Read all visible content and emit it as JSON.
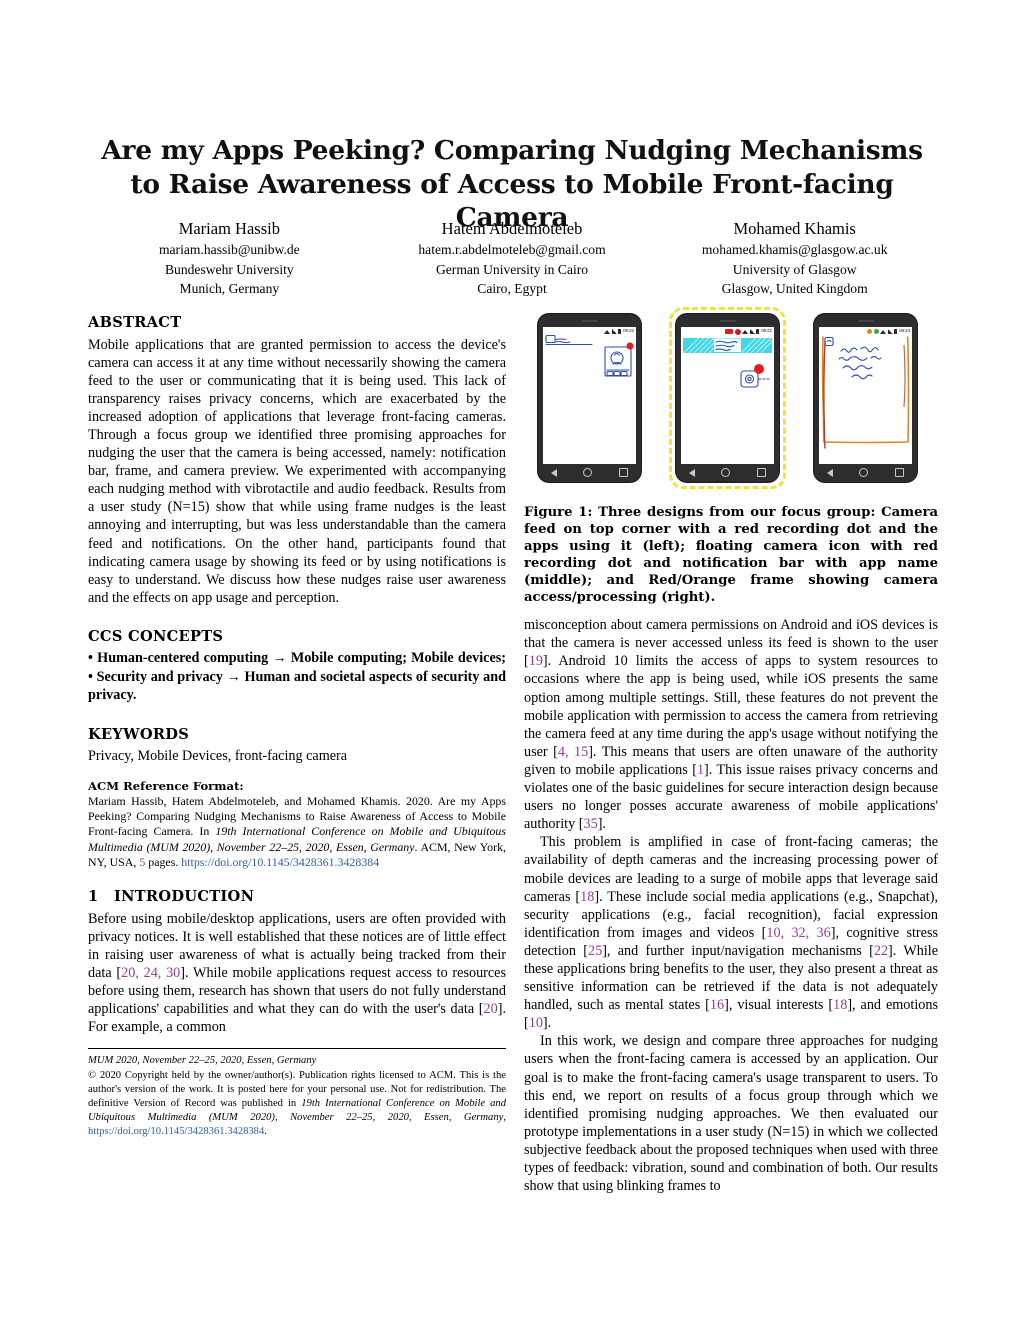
{
  "paper": {
    "title": "Are my Apps Peeking? Comparing Nudging Mechanisms to Raise Awareness of Access to Mobile Front-facing Camera",
    "authors": [
      {
        "name": "Mariam Hassib",
        "email": "mariam.hassib@unibw.de",
        "affiliation": "Bundeswehr University",
        "city": "Munich, Germany"
      },
      {
        "name": "Hatem Abdelmoteleb",
        "email": "hatem.r.abdelmoteleb@gmail.com",
        "affiliation": "German University in Cairo",
        "city": "Cairo, Egypt"
      },
      {
        "name": "Mohamed Khamis",
        "email": "mohamed.khamis@glasgow.ac.uk",
        "affiliation": "University of Glasgow",
        "city": "Glasgow, United Kingdom"
      }
    ]
  },
  "abstract": {
    "heading": "ABSTRACT",
    "text": "Mobile applications that are granted permission to access the device's camera can access it at any time without necessarily showing the camera feed to the user or communicating that it is being used. This lack of transparency raises privacy concerns, which are exacerbated by the increased adoption of applications that leverage front-facing cameras. Through a focus group we identified three promising approaches for nudging the user that the camera is being accessed, namely: notification bar, frame, and camera preview. We experimented with accompanying each nudging method with vibrotactile and audio feedback. Results from a user study (N=15) show that while using frame nudges is the least annoying and interrupting, but was less understandable than the camera feed and notifications. On the other hand, participants found that indicating camera usage by showing its feed or by using notifications is easy to understand. We discuss how these nudges raise user awareness and the effects on app usage and perception."
  },
  "ccs": {
    "heading": "CCS CONCEPTS",
    "text": "• Human-centered computing → Mobile computing; Mobile devices; • Security and privacy → Human and societal aspects of security and privacy."
  },
  "keywords": {
    "heading": "KEYWORDS",
    "text": "Privacy, Mobile Devices, front-facing camera"
  },
  "acm_reference": {
    "heading": "ACM Reference Format:",
    "part1": "Mariam Hassib, Hatem Abdelmoteleb, and Mohamed Khamis. 2020. Are my Apps Peeking? Comparing Nudging Mechanisms to Raise Awareness of Access to Mobile Front-facing Camera. In ",
    "venue_italic": "19th International Conference on Mobile and Ubiquitous Multimedia (MUM 2020), November 22–25, 2020, Essen, Germany",
    "part2": ". ACM, New York, NY, USA, ",
    "pages_count": "5",
    "part3": " pages. ",
    "doi": "https://doi.org/10.1145/3428361.3428384"
  },
  "introduction": {
    "number": "1",
    "heading": "INTRODUCTION",
    "para1_a": "Before using mobile/desktop applications, users are often provided with privacy notices. It is well established that these notices are of little effect in raising user awareness of what is actually being tracked from their data [",
    "para1_cite1": "20, 24, 30",
    "para1_b": "]. While mobile applications request access to resources before using them, research has shown that users do not fully understand applications' capabilities and what they can do with the user's data [",
    "para1_cite2": "20",
    "para1_c": "]. For example, a common"
  },
  "footer": {
    "venue_line": "MUM 2020, November 22–25, 2020, Essen, Germany",
    "copyright_a": "© 2020 Copyright held by the owner/author(s). Publication rights licensed to ACM. This is the author's version of the work. It is posted here for your personal use. Not for redistribution. The definitive Version of Record was published in ",
    "copyright_italic": "19th International Conference on Mobile and Ubiquitous Multimedia (MUM 2020), November 22–25, 2020, Essen, Germany",
    "copyright_b": ", ",
    "doi": "https://doi.org/10.1145/3428361.3428384",
    "copyright_c": "."
  },
  "figure": {
    "caption_label": "Figure 1:",
    "caption_text": " Three designs from our focus group: Camera feed on top corner with a red recording dot and the apps using it (left); floating camera icon with red recording dot and notification bar with app name (middle); and Red/Orange frame showing camera access/processing (right).",
    "phones": [
      {
        "label": "camera-feed-top-corner",
        "status_time": "09:22",
        "frame_color": "none"
      },
      {
        "label": "floating-camera-icon-notification",
        "status_time": "09:22",
        "frame_color": "#f2e23a"
      },
      {
        "label": "red-orange-frame",
        "status_time": "09:23",
        "frame_color": "#e8841f"
      }
    ]
  },
  "right_column": {
    "para_a_1": "misconception about camera permissions on Android and iOS devices is that the camera is never accessed unless its feed is shown to the user [",
    "para_a_c1": "19",
    "para_a_2": "]. Android 10 limits the access of apps to system resources to occasions where the app is being used, while iOS presents the same option among multiple settings. Still, these features do not prevent the mobile application with permission to access the camera from retrieving the camera feed at any time during the app's usage without notifying the user [",
    "para_a_c2": "4, 15",
    "para_a_3": "]. This means that users are often unaware of the authority given to mobile applications [",
    "para_a_c3": "1",
    "para_a_4": "]. This issue raises privacy concerns and violates one of the basic guidelines for secure interaction design because users no longer posses accurate awareness of mobile applications' authority [",
    "para_a_c4": "35",
    "para_a_5": "].",
    "para_b_1": "This problem is amplified in case of front-facing cameras; the availability of depth cameras and the increasing processing power of mobile devices are leading to a surge of mobile apps that leverage said cameras [",
    "para_b_c1": "18",
    "para_b_2": "]. These include social media applications (e.g., Snapchat), security applications (e.g., facial recognition), facial expression identification from images and videos [",
    "para_b_c2": "10, 32, 36",
    "para_b_3": "], cognitive stress detection [",
    "para_b_c3": "25",
    "para_b_4": "], and further input/navigation mechanisms [",
    "para_b_c4": "22",
    "para_b_5": "]. While these applications bring benefits to the user, they also present a threat as sensitive information can be retrieved if the data is not adequately handled, such as mental states [",
    "para_b_c5": "16",
    "para_b_6": "], visual interests [",
    "para_b_c6": "18",
    "para_b_7": "], and emotions [",
    "para_b_c7": "10",
    "para_b_8": "].",
    "para_c_1": "In this work, we design and compare three approaches for nudging users when the front-facing camera is accessed by an application. Our goal is to make the front-facing camera's usage transparent to users. To this end, we report on results of a focus group through which we identified promising nudging approaches. We then evaluated our prototype implementations in a user study (N=15) in which we collected subjective feedback about the proposed techniques when used with three types of feedback: vibration, sound and combination of both. Our results show that using blinking frames to"
  }
}
